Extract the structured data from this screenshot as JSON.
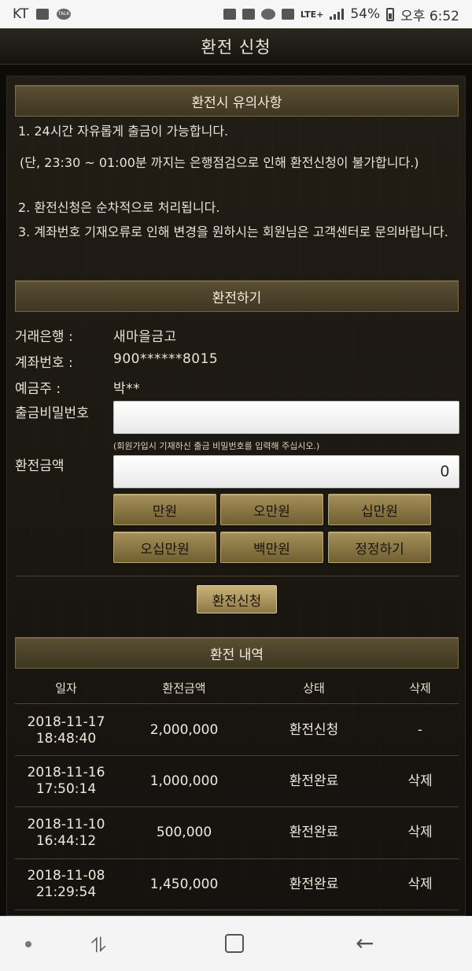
{
  "status_bar": {
    "carrier": "KT",
    "network": "LTE+",
    "battery": "54%",
    "time": "오후 6:52"
  },
  "header": {
    "title": "환전 신청"
  },
  "notice": {
    "title": "환전시 유의사항",
    "lines": [
      "1. 24시간 자유롭게 출금이 가능합니다.",
      "(단, 23:30 ~ 01:00분 까지는 은행점검으로 인해 환전신청이 불가합니다.)",
      "2. 환전신청은 순차적으로 처리됩니다.",
      "3. 계좌번호 기재오류로 인해 변경을 원하시는 회원님은 고객센터로 문의바랍니다."
    ]
  },
  "form": {
    "title": "환전하기",
    "bank_label": "거래은행 :",
    "bank_value": "새마을금고",
    "account_label": "계좌번호 :",
    "account_value": "900******8015",
    "holder_label": "예금주 :",
    "holder_value": "박**",
    "password_label": "출금비밀번호",
    "password_value": "",
    "password_hint": "(회원가입시 기재하신 출금 비밀번호를 입력해 주십시오.)",
    "amount_label": "환전금액",
    "amount_value": "0",
    "quick_buttons": [
      "만원",
      "오만원",
      "십만원",
      "오십만원",
      "백만원",
      "정정하기"
    ],
    "submit_label": "환전신청"
  },
  "history": {
    "title": "환전 내역",
    "columns": [
      "일자",
      "환전금액",
      "상태",
      "삭제"
    ],
    "rows": [
      {
        "date": "2018-11-17",
        "time": "18:48:40",
        "amount": "2,000,000",
        "status": "환전신청",
        "delete": "-"
      },
      {
        "date": "2018-11-16",
        "time": "17:50:14",
        "amount": "1,000,000",
        "status": "환전완료",
        "delete": "삭제"
      },
      {
        "date": "2018-11-10",
        "time": "16:44:12",
        "amount": "500,000",
        "status": "환전완료",
        "delete": "삭제"
      },
      {
        "date": "2018-11-08",
        "time": "21:29:54",
        "amount": "1,450,000",
        "status": "환전완료",
        "delete": "삭제"
      }
    ]
  }
}
